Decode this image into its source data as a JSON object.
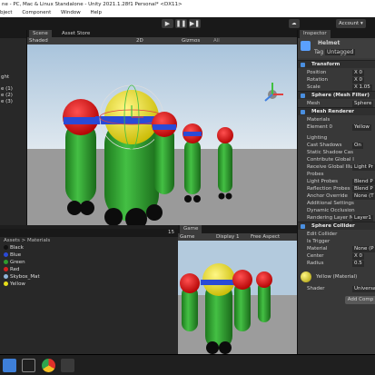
{
  "window": {
    "title": "ne - PC, Mac & Linux Standalone - Unity 2021.1.28f1 Personal* <DX11>"
  },
  "menu": [
    "bject",
    "Component",
    "Window",
    "Help"
  ],
  "toolbar": {
    "account": "Account"
  },
  "hierarchy": {
    "items": [
      "ght",
      "e (1)",
      "e (2)",
      "e (3)"
    ]
  },
  "scene": {
    "tabs": [
      "Scene",
      "Asset Store"
    ],
    "shading": "Shaded",
    "mode_2d": "2D",
    "gizmos": "Gizmos",
    "search_placeholder": "All"
  },
  "project": {
    "breadcrumb": "Assets > Materials",
    "items": [
      {
        "name": "Black",
        "color": "#111111"
      },
      {
        "name": "Blue",
        "color": "#2a4ad6"
      },
      {
        "name": "Green",
        "color": "#2f9a2f"
      },
      {
        "name": "Red",
        "color": "#d42020"
      },
      {
        "name": "Skybox_Mat",
        "color": "#8fb4d8"
      },
      {
        "name": "Yellow",
        "color": "#e6dd1a"
      }
    ],
    "item_count": "15"
  },
  "game": {
    "tab": "Game",
    "display": "Game",
    "display_num": "Display 1",
    "aspect": "Free Aspect"
  },
  "inspector": {
    "tab": "Inspector",
    "object_name": "Helmet",
    "tag_label": "Tag",
    "tag_value": "Untagged",
    "transform": "Transform",
    "position_label": "Position",
    "rotation_label": "Rotation",
    "scale_label": "Scale",
    "position_x": "X 0",
    "rotation_x": "X 0",
    "scale_x": "X 1.05",
    "mesh_filter": "Sphere (Mesh Filter)",
    "mesh_label": "Mesh",
    "mesh_value": "Sphere",
    "mesh_renderer": "Mesh Renderer",
    "materials_label": "Materials",
    "element0_label": "Element 0",
    "element0_value": "Yellow",
    "lighting_label": "Lighting",
    "cast_shadows_label": "Cast Shadows",
    "cast_shadows_value": "On",
    "static_shadow_label": "Static Shadow Cas",
    "contribute_gi_label": "Contribute Global I",
    "receive_gi_label": "Receive Global Illur",
    "receive_gi_value": "Light Pr",
    "probes_label": "Probes",
    "light_probes_label": "Light Probes",
    "light_probes_value": "Blend P",
    "reflection_probes_label": "Reflection Probes",
    "reflection_probes_value": "Blend P",
    "anchor_override_label": "Anchor Override",
    "anchor_override_value": "None (T",
    "additional_settings_label": "Additional Settings",
    "dynamic_occlusion_label": "Dynamic Occlusion",
    "rendering_layer_label": "Rendering Layer M",
    "rendering_layer_value": "Layer1",
    "sphere_collider": "Sphere Collider",
    "edit_collider_label": "Edit Collider",
    "is_trigger_label": "Is Trigger",
    "material_label": "Material",
    "material_value": "None (P",
    "center_label": "Center",
    "center_value": "X 0",
    "radius_label": "Radius",
    "radius_value": "0.5",
    "material_name": "Yellow (Material)",
    "shader_label": "Shader",
    "shader_value": "Universal Rend",
    "add_component": "Add Comp"
  },
  "colors": {
    "red": "#d42020",
    "yellow": "#e6dd1a",
    "green": "#2f9a2f",
    "blue": "#2a4ad6",
    "black": "#0c0c0c",
    "accent": "#4a8fe0"
  }
}
